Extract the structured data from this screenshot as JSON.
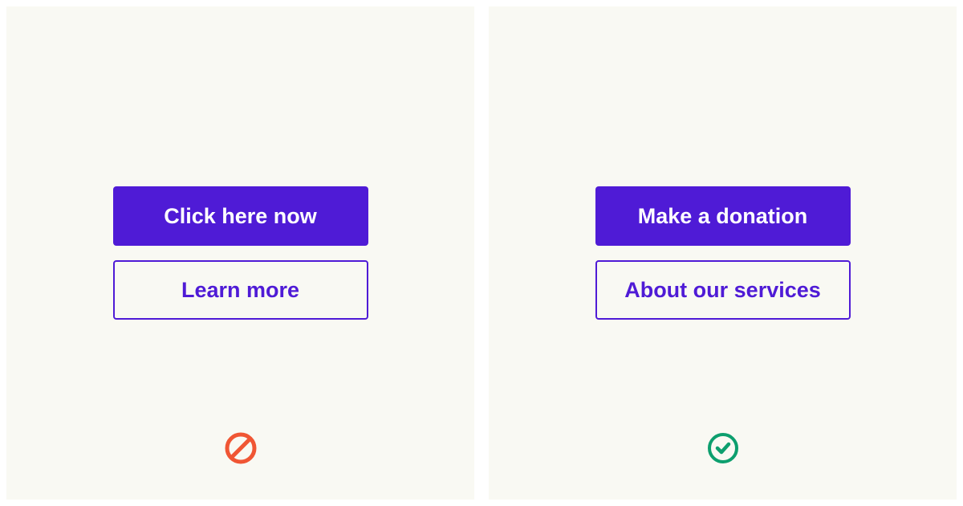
{
  "left_panel": {
    "primary_button_label": "Click here now",
    "secondary_button_label": "Learn more",
    "status": "incorrect"
  },
  "right_panel": {
    "primary_button_label": "Make a donation",
    "secondary_button_label": "About our services",
    "status": "correct"
  },
  "colors": {
    "panel_bg": "#f9f9f3",
    "primary": "#4f1bd6",
    "error": "#f05634",
    "success": "#0d9f6e"
  }
}
